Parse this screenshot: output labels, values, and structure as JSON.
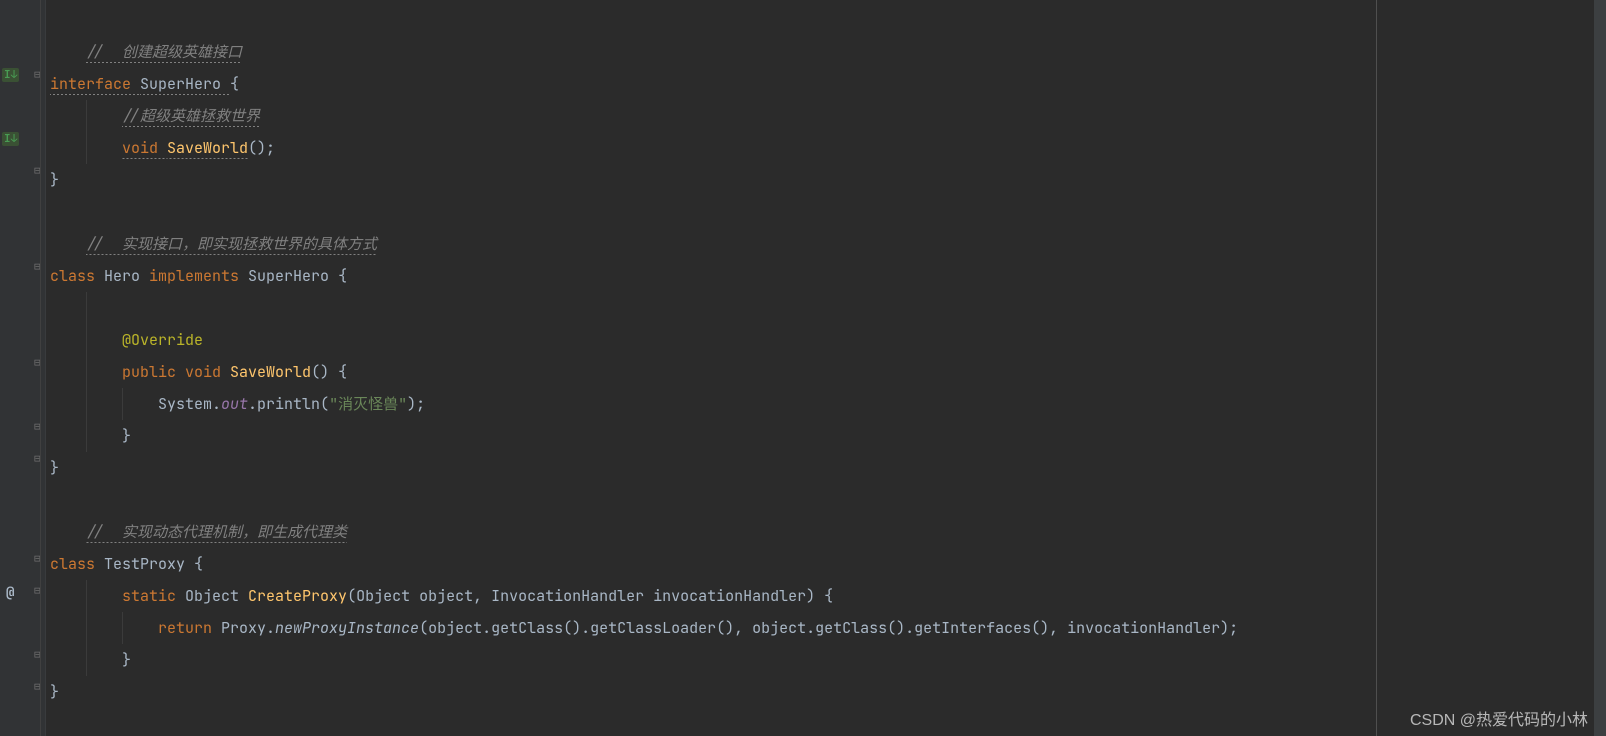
{
  "code": {
    "l1_comment": "//  创建超级英雄接口",
    "l2_kw_interface": "interface ",
    "l2_name": "SuperHero ",
    "l2_brace": "{",
    "l3_comment": "//超级英雄拯救世界",
    "l4_kw_void": "void ",
    "l4_method": "SaveWorld",
    "l4_parens": "();",
    "l5_brace": "}",
    "l7_comment": "//  实现接口，即实现拯救世界的具体方式",
    "l8_kw_class": "class ",
    "l8_name": "Hero ",
    "l8_kw_impl": "implements ",
    "l8_iface": "SuperHero ",
    "l8_brace": "{",
    "l10_anno": "@Override",
    "l11_kw_public": "public ",
    "l11_kw_void": "void ",
    "l11_method": "SaveWorld",
    "l11_parens": "() {",
    "l12_sys": "System.",
    "l12_out": "out",
    "l12_println": ".println(",
    "l12_str": "\"消灭怪兽\"",
    "l12_end": ");",
    "l13_brace": "}",
    "l14_brace": "}",
    "l16_comment": "//  实现动态代理机制，即生成代理类",
    "l17_kw_class": "class ",
    "l17_name": "TestProxy ",
    "l17_brace": "{",
    "l18_kw_static": "static ",
    "l18_type": "Object ",
    "l18_method": "CreateProxy",
    "l18_params_open": "(",
    "l18_p1t": "Object ",
    "l18_p1n": "object",
    "l18_c1": ", ",
    "l18_p2t": "InvocationHandler ",
    "l18_p2n": "invocationHandler",
    "l18_params_close": ") {",
    "l19_kw_return": "return ",
    "l19_proxy": "Proxy.",
    "l19_npi": "newProxyInstance",
    "l19_call": "(object.getClass().getClassLoader(), object.getClass().getInterfaces(), invocationHandler);",
    "l20_brace": "}",
    "l21_brace": "}"
  },
  "gutter": {
    "impl1": "I↓",
    "impl2": "I↓",
    "at": "@",
    "fold_open": "⊟",
    "fold_close": "⊟"
  },
  "watermark": "CSDN @热爱代码的小林"
}
